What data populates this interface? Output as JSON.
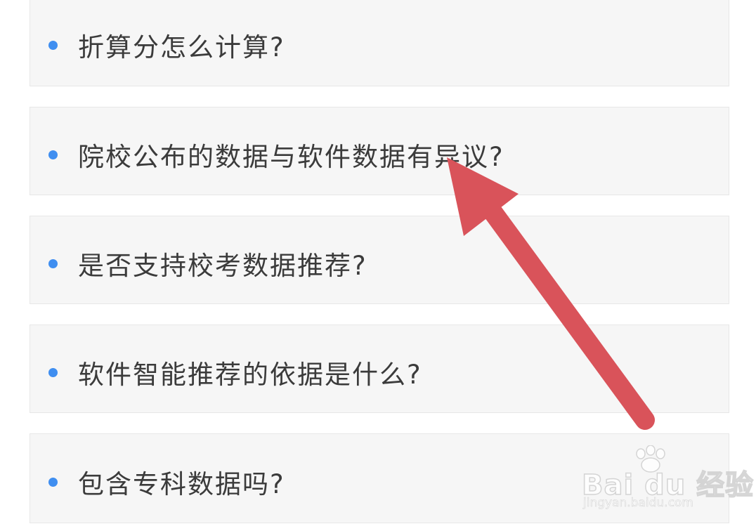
{
  "faq": {
    "items": [
      {
        "label": "折算分怎么计算?"
      },
      {
        "label": "院校公布的数据与软件数据有异议?"
      },
      {
        "label": "是否支持校考数据推荐?"
      },
      {
        "label": "软件智能推荐的依据是什么?"
      },
      {
        "label": "包含专科数据吗?"
      }
    ]
  },
  "annotation": {
    "arrow_color": "#d9535a",
    "points_to": "院校公布的数据与软件数据有异议?"
  },
  "watermark": {
    "brand": "Bai du 经验",
    "url": "jingyan.baidu.com"
  },
  "colors": {
    "bullet": "#3f8ef0",
    "item_background": "#f6f6f6",
    "text": "#3b3b3b"
  }
}
